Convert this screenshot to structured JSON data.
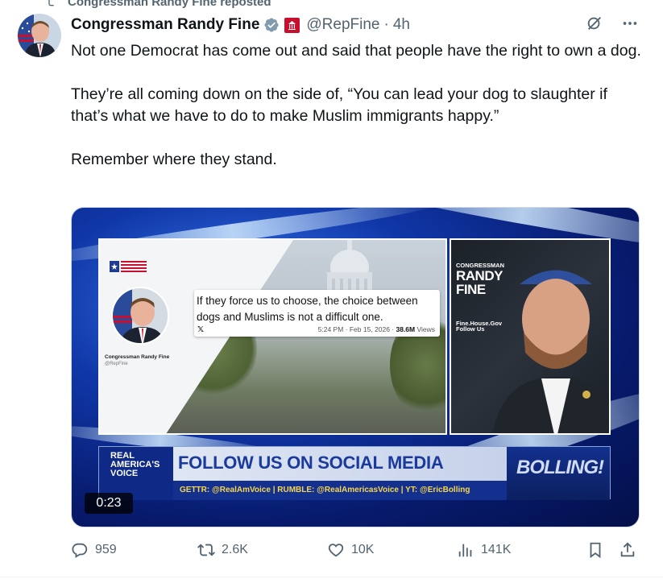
{
  "repost": {
    "text": "Congressman Randy Fine reposted"
  },
  "author": {
    "name": "Congressman Randy Fine",
    "handle": "@RepFine",
    "time": "4h"
  },
  "tweet": {
    "paragraphs": [
      "Not one Democrat has come out and said that people have the right to own a dog.",
      "They’re all coming down on the side of, “You can lead your dog to slaughter if that’s what we have to do to make Muslim immigrants happy.”",
      "Remember where they stand."
    ]
  },
  "media": {
    "duration": "0:23",
    "quoted_post": {
      "author_name": "Congressman Randy Fine",
      "author_handle": "@RepFine",
      "text": "If they force us to choose, the choice between dogs and Muslims is not a difficult one.",
      "x_mark": "𝕏",
      "meta_time": "5:24 PM · Feb 15, 2026 · ",
      "meta_views": "38.6M",
      "meta_views_label": " Views"
    },
    "banner": {
      "line1": "CONGRESSMAN",
      "line2": "RANDY",
      "line3": "FINE",
      "line4": "Fine.House.Gov",
      "line5": "Follow Us"
    },
    "lower_third": {
      "logo_line1": "REAL",
      "logo_line2": "AMERICA'S",
      "logo_line3": "VOICE",
      "headline": "FOLLOW US ON SOCIAL MEDIA",
      "subline": "GETTR: @RealAmVoice | RUMBLE: @RealAmericasVoice | YT: @EricBolling",
      "show_name": "BOLLING!"
    }
  },
  "actions": {
    "replies": "959",
    "reposts": "2.6K",
    "likes": "10K",
    "views": "141K"
  },
  "colors": {
    "text_primary": "#0f1419",
    "text_secondary": "#536471",
    "verified_blue": "#1d9bf0",
    "gov_red": "#c8102e"
  }
}
